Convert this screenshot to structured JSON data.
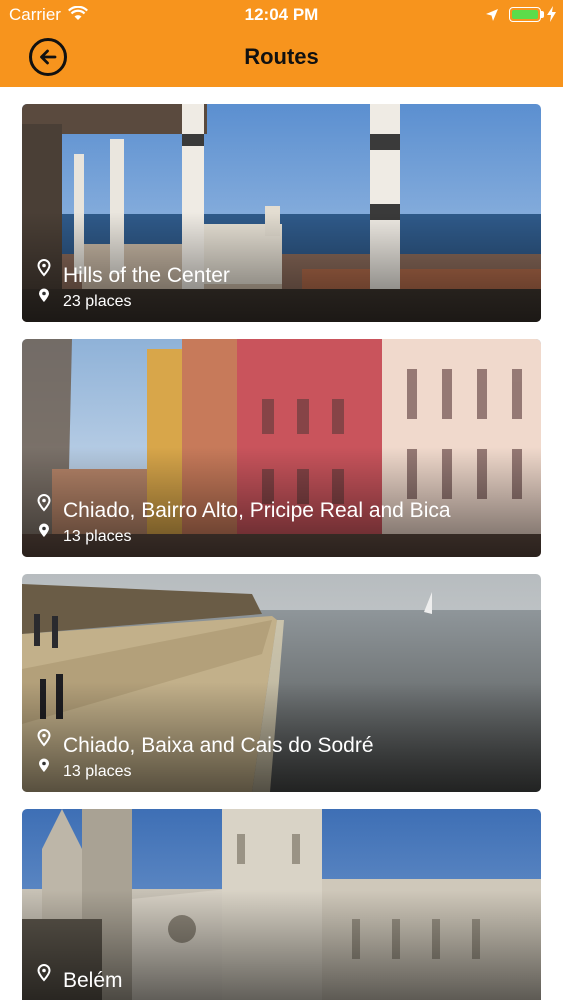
{
  "status_bar": {
    "carrier": "Carrier",
    "time": "12:04 PM",
    "battery_level": 1.0,
    "battery_color": "#5cdc4a"
  },
  "nav": {
    "title": "Routes",
    "back_icon": "arrow-left-circle-icon",
    "background": "#f7941d"
  },
  "routes": [
    {
      "title": "Hills of the Center",
      "places": "23 places"
    },
    {
      "title": "Chiado, Bairro Alto, Pricipe Real and Bica",
      "places": "13 places"
    },
    {
      "title": "Chiado, Baixa and Cais do Sodré",
      "places": "13 places"
    },
    {
      "title": "Belém",
      "places": ""
    }
  ]
}
